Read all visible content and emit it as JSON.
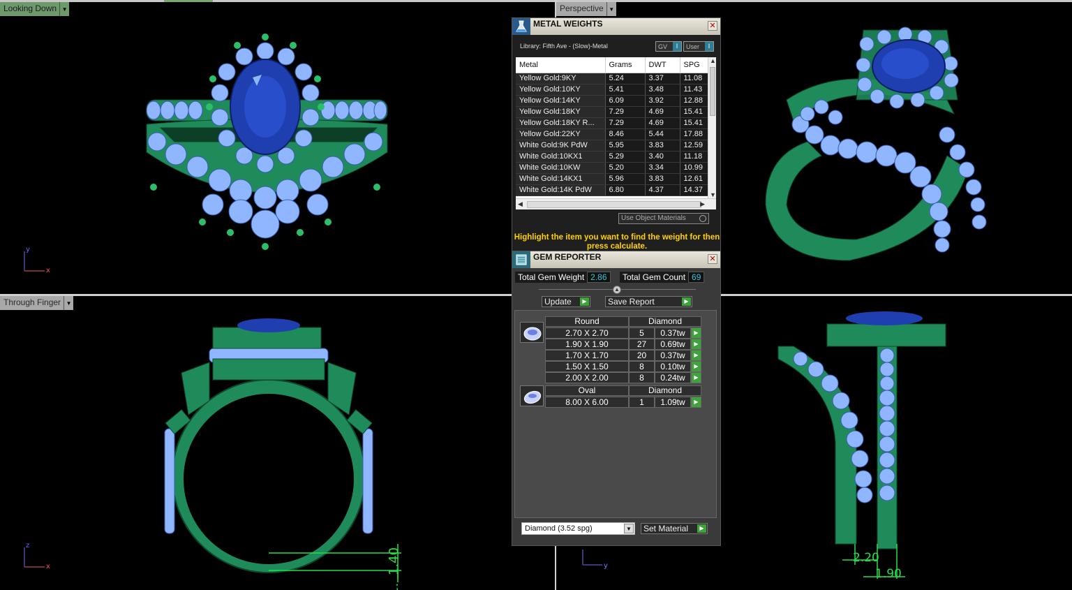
{
  "viewports": {
    "top_left": {
      "label": "Looking Down"
    },
    "top_right": {
      "label": "Perspective"
    },
    "bottom_left": {
      "label": "Through Finger"
    }
  },
  "axes": {
    "x": "x",
    "y": "y",
    "z": "z"
  },
  "dimensions": {
    "d1": "1.40",
    "d2": "2.20",
    "d3": "1.90"
  },
  "metal_weights": {
    "title": "METAL WEIGHTS",
    "library": "Library: Fifth Ave - (Slow)-Metal",
    "toggle_gv": "GV",
    "toggle_user": "User",
    "toggle_knob": "I",
    "columns": [
      "Metal",
      "Grams",
      "DWT",
      "SPG"
    ],
    "rows": [
      [
        "Yellow Gold:9KY",
        "5.24",
        "3.37",
        "11.08"
      ],
      [
        "Yellow Gold:10KY",
        "5.41",
        "3.48",
        "11.43"
      ],
      [
        "Yellow Gold:14KY",
        "6.09",
        "3.92",
        "12.88"
      ],
      [
        "Yellow Gold:18KY",
        "7.29",
        "4.69",
        "15.41"
      ],
      [
        "Yellow Gold:18KY R...",
        "7.29",
        "4.69",
        "15.41"
      ],
      [
        "Yellow Gold:22KY",
        "8.46",
        "5.44",
        "17.88"
      ],
      [
        "White Gold:9K PdW",
        "5.95",
        "3.83",
        "12.59"
      ],
      [
        "White Gold:10KX1",
        "5.29",
        "3.40",
        "11.18"
      ],
      [
        "White Gold:10KW",
        "5.20",
        "3.34",
        "10.99"
      ],
      [
        "White Gold:14KX1",
        "5.96",
        "3.83",
        "12.61"
      ],
      [
        "White Gold:14K PdW",
        "6.80",
        "4.37",
        "14.37"
      ]
    ],
    "use_object_materials": "Use Object Materials",
    "hint": "Highlight the item you want to find the weight for then press calculate."
  },
  "gem_reporter": {
    "title": "GEM REPORTER",
    "total_weight_label": "Total Gem Weight",
    "total_weight": "2.86",
    "total_count_label": "Total Gem Count",
    "total_count": "69",
    "update_label": "Update",
    "save_label": "Save Report",
    "groups": [
      {
        "shape": "Round",
        "material": "Diamond",
        "rows": [
          [
            "2.70 X 2.70",
            "5",
            "0.37tw"
          ],
          [
            "1.90 X 1.90",
            "27",
            "0.69tw"
          ],
          [
            "1.70 X 1.70",
            "20",
            "0.37tw"
          ],
          [
            "1.50 X 1.50",
            "8",
            "0.10tw"
          ],
          [
            "2.00 X 2.00",
            "8",
            "0.24tw"
          ]
        ]
      },
      {
        "shape": "Oval",
        "material": "Diamond",
        "rows": [
          [
            "8.00 X 6.00",
            "1",
            "1.09tw"
          ]
        ]
      }
    ],
    "material_select": "Diamond     (3.52 spg)",
    "set_material_label": "Set Material"
  },
  "colors": {
    "metal": "#1f8a5a",
    "gem": "#8fb6ff",
    "stone": "#1f3fb0",
    "label_green": "#6d9a6b",
    "hint": "#ffd100"
  }
}
